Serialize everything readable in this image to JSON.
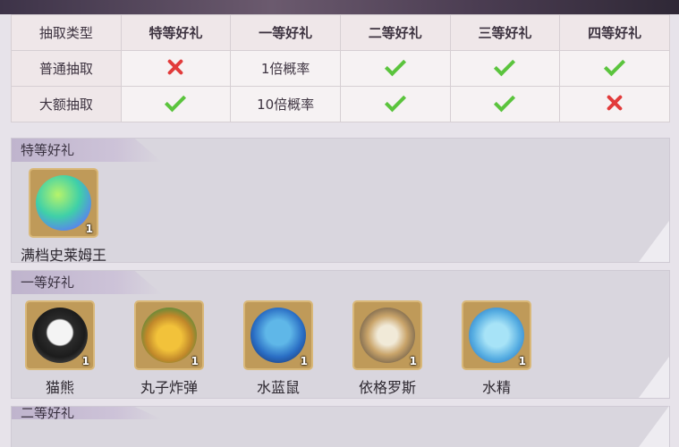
{
  "table": {
    "headers": [
      "抽取类型",
      "特等好礼",
      "一等好礼",
      "二等好礼",
      "三等好礼",
      "四等好礼"
    ],
    "rows": [
      {
        "type": "普通抽取",
        "cells": [
          {
            "kind": "cross"
          },
          {
            "kind": "text",
            "text": "1倍概率"
          },
          {
            "kind": "check"
          },
          {
            "kind": "check"
          },
          {
            "kind": "check"
          }
        ]
      },
      {
        "type": "大额抽取",
        "cells": [
          {
            "kind": "check"
          },
          {
            "kind": "text",
            "text": "10倍概率"
          },
          {
            "kind": "check"
          },
          {
            "kind": "check"
          },
          {
            "kind": "cross"
          }
        ]
      }
    ]
  },
  "sections": [
    {
      "title": "特等好礼",
      "items": [
        {
          "name": "满档史莱姆王",
          "count": "1",
          "icon": "slime-king-icon"
        }
      ]
    },
    {
      "title": "一等好礼",
      "items": [
        {
          "name": "猫熊",
          "count": "1",
          "icon": "panda-icon"
        },
        {
          "name": "丸子炸弹",
          "count": "1",
          "icon": "ball-bomb-icon"
        },
        {
          "name": "水蓝鼠",
          "count": "1",
          "icon": "water-mouse-icon"
        },
        {
          "name": "依格罗斯",
          "count": "1",
          "icon": "igros-icon"
        },
        {
          "name": "水精",
          "count": "1",
          "icon": "water-spirit-icon"
        }
      ]
    },
    {
      "title": "二等好礼",
      "items": []
    }
  ],
  "colors": {
    "check": "#5bc43d",
    "cross": "#e23b3b",
    "item_frame": "#bf9a59"
  }
}
